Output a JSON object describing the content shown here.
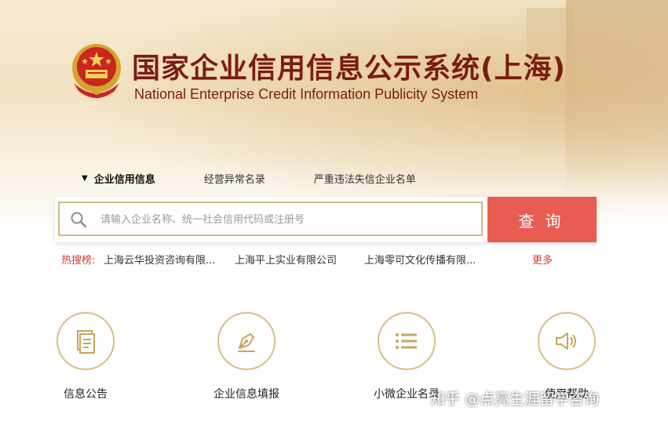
{
  "header": {
    "title": "国家企业信用信息公示系统(上海)",
    "subtitle": "National Enterprise Credit Information Publicity System"
  },
  "tabs": [
    {
      "label": "企业信用信息",
      "active": true
    },
    {
      "label": "经营异常名录",
      "active": false
    },
    {
      "label": "严重违法失信企业名单",
      "active": false
    }
  ],
  "search": {
    "placeholder": "请输入企业名称、统一社会信用代码或注册号",
    "value": "",
    "button_label": "查询"
  },
  "hot_search": {
    "label": "热搜榜:",
    "items": [
      "上海云华投资咨询有限...",
      "上海平上实业有限公司",
      "上海零可文化传播有限..."
    ],
    "more_label": "更多"
  },
  "features": [
    {
      "label": "信息公告",
      "icon": "document-icon"
    },
    {
      "label": "企业信息填报",
      "icon": "pen-icon"
    },
    {
      "label": "小微企业名录",
      "icon": "list-icon"
    },
    {
      "label": "使用帮助",
      "icon": "speaker-icon"
    }
  ],
  "watermark": "知乎 @点亮生涯留学咨询",
  "colors": {
    "title": "#7b1c12",
    "accent_red": "#e85c52",
    "gold_border": "#d8bd84",
    "hot_label": "#d03a2f"
  }
}
